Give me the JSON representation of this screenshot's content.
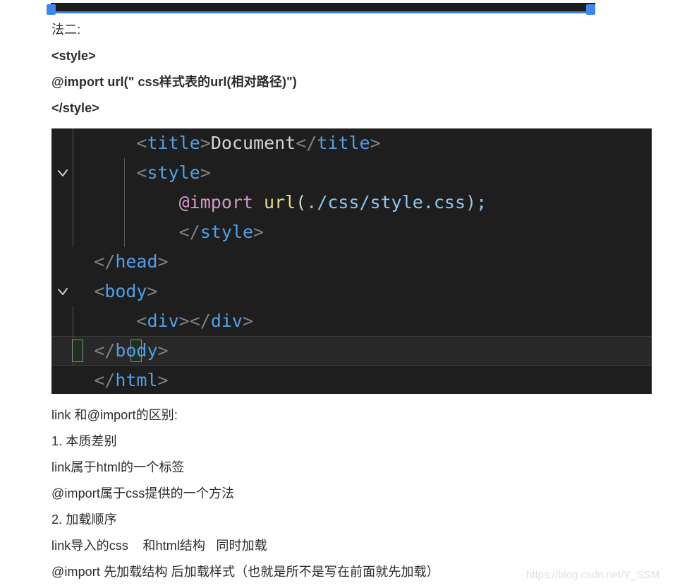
{
  "selection": {
    "handle_left_name": "resize-handle-left",
    "handle_right_name": "resize-handle-right"
  },
  "article": {
    "intro_lines": [
      {
        "text": "法二:",
        "bold": false
      },
      {
        "text": "<style>",
        "bold": true
      },
      {
        "text": "@import url(\" css样式表的url(相对路径)\")",
        "bold": true
      },
      {
        "text": "</style>",
        "bold": true
      }
    ],
    "outro_lines": [
      {
        "text": "link 和@import的区别:"
      },
      {
        "text": "1. 本质差别"
      },
      {
        "text": "link属于html的一个标签"
      },
      {
        "text": "@import属于css提供的一个方法"
      },
      {
        "text": "2. 加载顺序"
      },
      {
        "text": "link导入的css    和html结构   同时加载"
      },
      {
        "text": "@import 先加载结构 后加载样式（也就是所不是写在前面就先加载）"
      }
    ]
  },
  "code_block": {
    "theme": "vscode-dark",
    "background": "#1e1e1e",
    "lines": [
      {
        "id": "line-title",
        "folded": false,
        "active": false,
        "tokens": [
          {
            "text": "        ",
            "cls": "t-text"
          },
          {
            "text": "<",
            "cls": "t-punct"
          },
          {
            "text": "title",
            "cls": "t-tag"
          },
          {
            "text": ">",
            "cls": "t-punct"
          },
          {
            "text": "Document",
            "cls": "t-text"
          },
          {
            "text": "</",
            "cls": "t-punct"
          },
          {
            "text": "title",
            "cls": "t-tag"
          },
          {
            "text": ">",
            "cls": "t-punct"
          }
        ]
      },
      {
        "id": "line-style-open",
        "folded": true,
        "active": false,
        "tokens": [
          {
            "text": "        ",
            "cls": "t-text"
          },
          {
            "text": "<",
            "cls": "t-punct"
          },
          {
            "text": "style",
            "cls": "t-tag"
          },
          {
            "text": ">",
            "cls": "t-punct"
          }
        ]
      },
      {
        "id": "line-import",
        "folded": false,
        "active": false,
        "tokens": [
          {
            "text": "            ",
            "cls": "t-text"
          },
          {
            "text": "@import",
            "cls": "t-at"
          },
          {
            "text": " ",
            "cls": "t-text"
          },
          {
            "text": "url",
            "cls": "t-fn"
          },
          {
            "text": "(",
            "cls": "t-paren"
          },
          {
            "text": "./css/style.css",
            "cls": "t-str"
          },
          {
            "text": ")",
            "cls": "t-str"
          },
          {
            "text": ";",
            "cls": "t-str"
          }
        ]
      },
      {
        "id": "line-style-close",
        "folded": false,
        "active": false,
        "tokens": [
          {
            "text": "            ",
            "cls": "t-text"
          },
          {
            "text": "</",
            "cls": "t-punct"
          },
          {
            "text": "style",
            "cls": "t-tag"
          },
          {
            "text": ">",
            "cls": "t-punct"
          }
        ]
      },
      {
        "id": "line-head-close",
        "folded": false,
        "active": false,
        "tokens": [
          {
            "text": "    ",
            "cls": "t-text"
          },
          {
            "text": "</",
            "cls": "t-punct"
          },
          {
            "text": "head",
            "cls": "t-tag"
          },
          {
            "text": ">",
            "cls": "t-punct"
          }
        ]
      },
      {
        "id": "line-body-open",
        "folded": true,
        "active": false,
        "tokens": [
          {
            "text": "    ",
            "cls": "t-text"
          },
          {
            "text": "<",
            "cls": "t-punct"
          },
          {
            "text": "body",
            "cls": "t-tag"
          },
          {
            "text": ">",
            "cls": "t-punct"
          }
        ]
      },
      {
        "id": "line-div",
        "folded": false,
        "active": false,
        "tokens": [
          {
            "text": "        ",
            "cls": "t-text"
          },
          {
            "text": "<",
            "cls": "t-punct"
          },
          {
            "text": "div",
            "cls": "t-tag"
          },
          {
            "text": ">",
            "cls": "t-punct"
          },
          {
            "text": "</",
            "cls": "t-punct"
          },
          {
            "text": "div",
            "cls": "t-tag"
          },
          {
            "text": ">",
            "cls": "t-punct"
          }
        ]
      },
      {
        "id": "line-body-close",
        "folded": false,
        "active": true,
        "tokens": [
          {
            "text": "    ",
            "cls": "t-text"
          },
          {
            "text": "</",
            "cls": "t-punct"
          },
          {
            "text": "body",
            "cls": "t-tag"
          },
          {
            "text": ">",
            "cls": "t-punct"
          }
        ]
      },
      {
        "id": "line-html-close",
        "folded": false,
        "active": false,
        "tokens": [
          {
            "text": "    ",
            "cls": "t-text"
          },
          {
            "text": "</",
            "cls": "t-punct"
          },
          {
            "text": "html",
            "cls": "t-tag"
          },
          {
            "text": ">",
            "cls": "t-punct"
          }
        ]
      }
    ]
  },
  "watermark": {
    "text": "https://blog.csdn.net/Y_SSM"
  }
}
